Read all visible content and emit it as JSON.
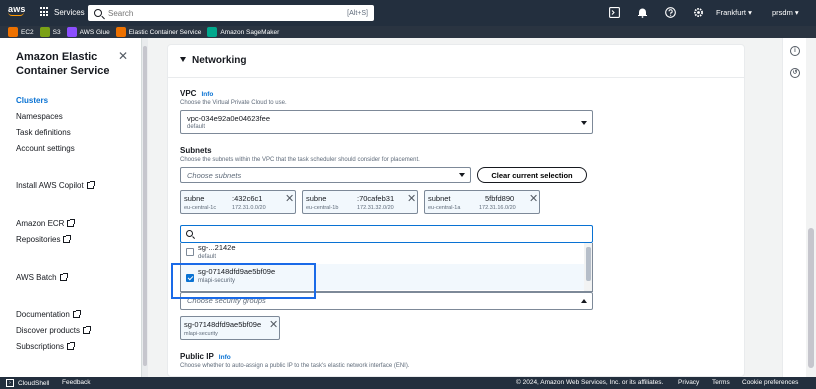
{
  "topnav": {
    "logo_text": "aws",
    "services_label": "Services",
    "search_placeholder": "Search",
    "search_shortcut": "[Alt+S]",
    "region": "Frankfurt ▾",
    "user": "prsdm ▾",
    "brand_color": "#232f3e",
    "accent_color": "#ff9900"
  },
  "favorites": [
    {
      "label": "EC2",
      "color": "#ed7100"
    },
    {
      "label": "S3",
      "color": "#7aa116"
    },
    {
      "label": "AWS Glue",
      "color": "#8c4fff"
    },
    {
      "label": "Elastic Container Service",
      "color": "#ed7100"
    },
    {
      "label": "Amazon SageMaker",
      "color": "#01a88d"
    }
  ],
  "sidebar": {
    "title": "Amazon Elastic Container Service",
    "items": {
      "clusters": "Clusters",
      "namespaces": "Namespaces",
      "task_definitions": "Task definitions",
      "account_settings": "Account settings",
      "install_copilot": "Install AWS Copilot",
      "amazon_ecr": "Amazon ECR",
      "repositories": "Repositories",
      "aws_batch": "AWS Batch",
      "documentation": "Documentation",
      "discover_products": "Discover products",
      "subscriptions": "Subscriptions"
    }
  },
  "networking": {
    "title": "Networking",
    "vpc": {
      "label": "VPC",
      "info": "Info",
      "description": "Choose the Virtual Private Cloud to use.",
      "value": "vpc-034e92a0e04623fee",
      "sub": "default"
    },
    "subnets": {
      "label": "Subnets",
      "description": "Choose the subnets within the VPC that the task scheduler should consider for placement.",
      "placeholder": "Choose subnets",
      "clear_button": "Clear current selection",
      "tokens": [
        {
          "name_a": "subne",
          "name_b": ":432c6c1",
          "zone": "eu-central-1c",
          "cidr": "172.31.0.0/20"
        },
        {
          "name_a": "subne",
          "name_b": ":70cafeb31",
          "zone": "eu-central-1b",
          "cidr": "172.31.32.0/20"
        },
        {
          "name_a": "subnet",
          "name_b": "5fbfd890",
          "zone": "eu-central-1a",
          "cidr": "172.31.16.0/20"
        }
      ]
    },
    "security_groups": {
      "search_value": "",
      "placeholder": "Choose security groups",
      "options": [
        {
          "id": "sg-...2142e",
          "name": "default",
          "checked": false
        },
        {
          "id": "sg-07148dfd9ae5bf09e",
          "name": "mlapi-security",
          "checked": true
        }
      ],
      "selected_token": {
        "id": "sg-07148dfd9ae5bf09e",
        "name": "mlapi-security"
      }
    },
    "public_ip": {
      "label": "Public IP",
      "info": "Info",
      "description": "Choose whether to auto-assign a public IP to the task's elastic network interface (ENI)."
    }
  },
  "footer": {
    "cloudshell": "CloudShell",
    "feedback": "Feedback",
    "copyright": "© 2024, Amazon Web Services, Inc. or its affiliates.",
    "privacy": "Privacy",
    "terms": "Terms",
    "cookies": "Cookie preferences"
  }
}
